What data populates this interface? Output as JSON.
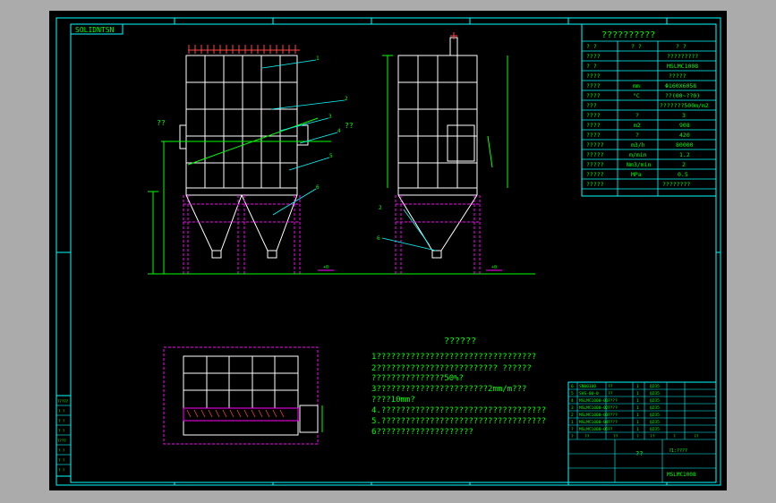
{
  "drawing": {
    "corner_tag": "SOLIDNTSN",
    "side_note_left": "??",
    "side_note_right": "??",
    "levels": [
      "+0",
      "+0"
    ],
    "part_numbers": [
      "1",
      "2",
      "3",
      "4",
      "5",
      "6",
      "2",
      "6"
    ]
  },
  "spec_table": {
    "title": "??????????",
    "rows": [
      [
        "? ?",
        "? ?",
        "? ?"
      ],
      [
        "????",
        "",
        "?????????"
      ],
      [
        "? ?",
        "",
        "MSLMC1008"
      ],
      [
        "????",
        "",
        "?????"
      ],
      [
        "????",
        "mm",
        "Φ160X6058"
      ],
      [
        "????",
        "°C",
        "??(00~??0)"
      ],
      [
        "???",
        "",
        "???????500m/m2"
      ],
      [
        "????",
        "?",
        "3"
      ],
      [
        "????",
        "m2",
        "908"
      ],
      [
        "????",
        "?",
        "420"
      ],
      [
        "?????",
        "m3/h",
        "80000"
      ],
      [
        "?????",
        "m/min",
        "1.2"
      ],
      [
        "?????",
        "Nm3/min",
        "2"
      ],
      [
        "?????",
        "MPa",
        "0.5"
      ],
      [
        "?????",
        "",
        "????????"
      ]
    ]
  },
  "notes": {
    "title": "??????",
    "lines": [
      "1?????????????????????????????????",
      "2????????????????????????? ??????",
      "  ???????????????50%?",
      "3???????????????????????2mm/m???",
      "  ????10mm?",
      "4.??????????????????????????????????",
      "5.??????????????????????????????????",
      "6????????????????????"
    ]
  },
  "parts_list": {
    "rows": [
      [
        "6",
        "SN00100",
        "??",
        "1",
        "Q235",
        "",
        ""
      ],
      [
        "5",
        "SHS-00-0",
        "??",
        "1",
        "Q235",
        "",
        ""
      ],
      [
        "4",
        "MSLMC1008-01",
        "????",
        "1",
        "Q235",
        "",
        ""
      ],
      [
        "3",
        "MSLMC1008-02",
        "????",
        "1",
        "Q235",
        "",
        ""
      ],
      [
        "2",
        "MSLMC1008-03",
        "????",
        "1",
        "Q235",
        "",
        ""
      ],
      [
        "1",
        "MSLMC1008-04",
        "????",
        "1",
        "Q235",
        "",
        ""
      ],
      [
        "?",
        "MSLMC1008-05",
        "??",
        "1",
        "Q235",
        "",
        ""
      ]
    ],
    "header": [
      "?",
      "??",
      "??",
      "?",
      "??",
      "?",
      "??"
    ]
  },
  "title_block": {
    "name": "??",
    "scale_label": "?1:????",
    "drawing_no": "MSLMC1008"
  },
  "left_revision_labels": [
    "?????",
    "? ?",
    "? ?",
    "? ?",
    "????",
    "? ?",
    "? ?",
    "? ?"
  ],
  "colors": {
    "background": "#000000",
    "frame": "#00ffff",
    "structure": "#ffffff",
    "hidden_line": "#ff00ff",
    "dimension": "#00ff00",
    "leader": "#00ffff",
    "red_detail": "#ff0000",
    "window_bg": "#ababab"
  }
}
